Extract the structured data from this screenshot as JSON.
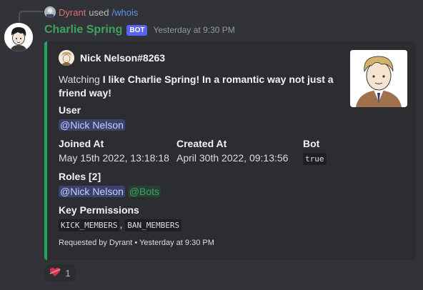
{
  "reply": {
    "name": "Dyrant",
    "used": "used",
    "command": "/whois"
  },
  "message": {
    "username": "Charlie Spring",
    "bot_tag": "BOT",
    "timestamp": "Yesterday at 9:30 PM"
  },
  "embed": {
    "accent": "#23a55a",
    "author": "Nick Nelson#8263",
    "desc_prefix": "Watching ",
    "desc_bold": "I like Charlie Spring! In a romantic way not just a friend way!",
    "fields": {
      "user": {
        "name": "User",
        "value": "@Nick Nelson"
      },
      "joined": {
        "name": "Joined At",
        "value": "May 15th 2022, 13:18:18"
      },
      "created": {
        "name": "Created At",
        "value": "April 30th 2022, 09:13:56"
      },
      "bot": {
        "name": "Bot",
        "value": "true"
      },
      "roles": {
        "name": "Roles [2]",
        "role1": "@Nick Nelson",
        "role2": "@Bots"
      },
      "perms": {
        "name": "Key Permissions",
        "perm1": "KICK_MEMBERS",
        "sep": ",",
        "perm2": "BAN_MEMBERS"
      }
    },
    "footer": "Requested by Dyrant • Yesterday at 9:30 PM"
  },
  "reaction": {
    "icon": "heart-icon",
    "count": "1"
  }
}
